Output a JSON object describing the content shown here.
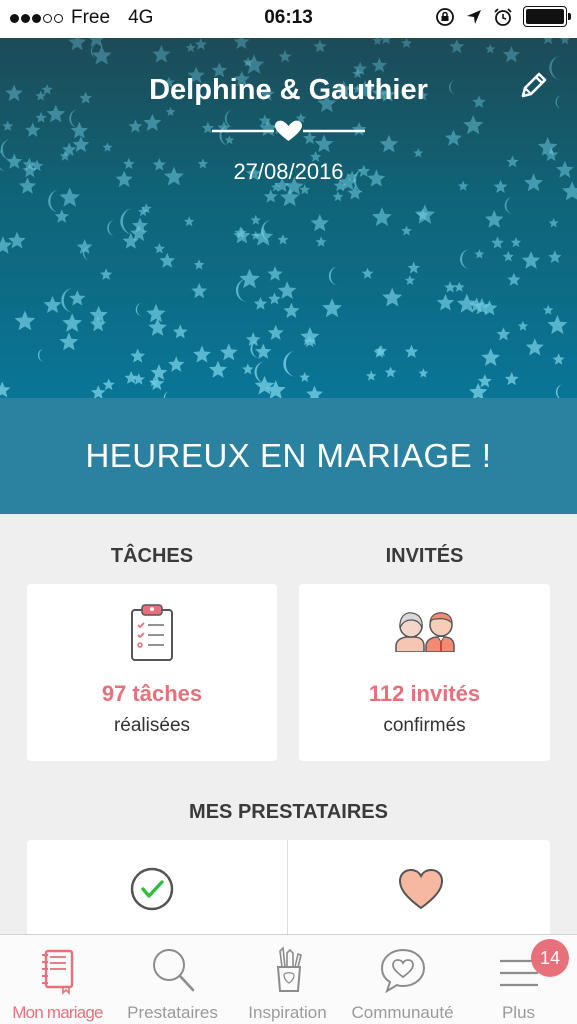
{
  "status_bar": {
    "carrier": "Free",
    "network": "4G",
    "time": "06:13"
  },
  "hero": {
    "names": "Delphine & Gauthier",
    "date": "27/08/2016"
  },
  "banner": {
    "text": "HEUREUX EN MARIAGE !"
  },
  "tasks": {
    "title": "TÂCHES",
    "value": "97 tâches",
    "caption": "réalisées"
  },
  "guests": {
    "title": "INVITÉS",
    "value": "112 invités",
    "caption": "confirmés"
  },
  "vendors": {
    "title": "MES PRESTATAIRES"
  },
  "tabs": [
    {
      "label": "Mon mariage",
      "icon": "notebook-icon"
    },
    {
      "label": "Prestataires",
      "icon": "search-icon"
    },
    {
      "label": "Inspiration",
      "icon": "pencil-cup-icon"
    },
    {
      "label": "Communauté",
      "icon": "chat-heart-icon"
    },
    {
      "label": "Plus",
      "icon": "menu-icon"
    }
  ],
  "more_badge": "14",
  "colors": {
    "accent": "#e8707a",
    "banner": "#2b82a0",
    "hero_top": "#1d4b57",
    "hero_bottom": "#0a7597"
  }
}
